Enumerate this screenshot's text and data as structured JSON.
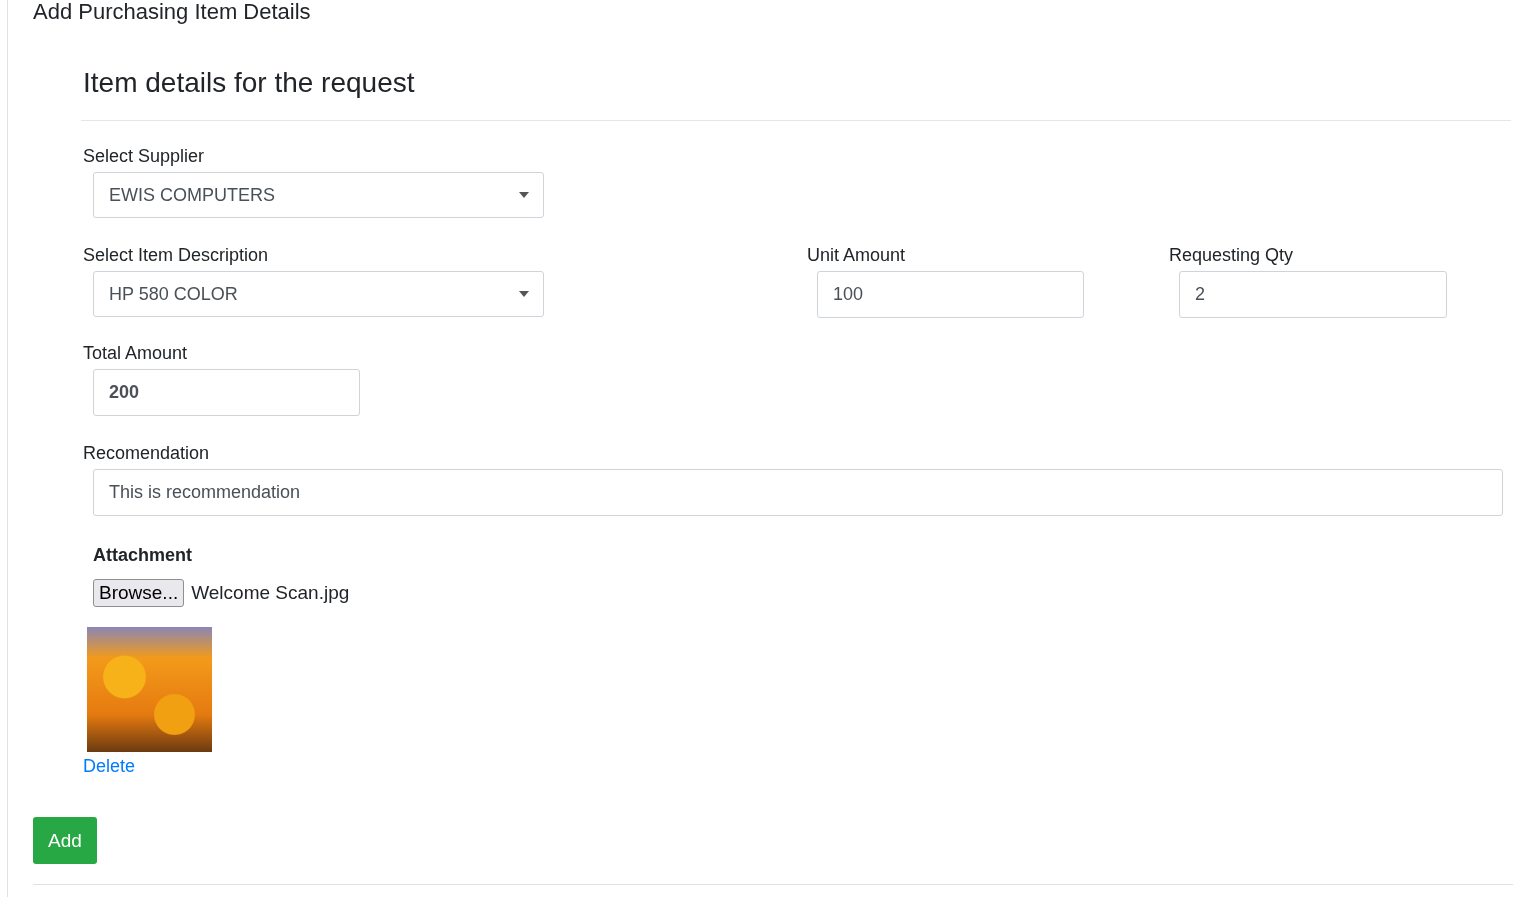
{
  "page_title": "Add Purchasing Item Details",
  "section_title": "Item details for the request",
  "supplier": {
    "label": "Select Supplier",
    "value": "EWIS COMPUTERS"
  },
  "item_description": {
    "label": "Select Item Description",
    "value": "HP 580 COLOR"
  },
  "unit_amount": {
    "label": "Unit Amount",
    "value": "100"
  },
  "requesting_qty": {
    "label": "Requesting Qty",
    "value": "2"
  },
  "total_amount": {
    "label": "Total Amount",
    "value": "200"
  },
  "recommendation": {
    "label": "Recomendation",
    "value": "This is recommendation"
  },
  "attachment": {
    "label": "Attachment",
    "button": "Browse...",
    "file_name": "Welcome Scan.jpg",
    "delete_link": "Delete"
  },
  "add_button": "Add"
}
